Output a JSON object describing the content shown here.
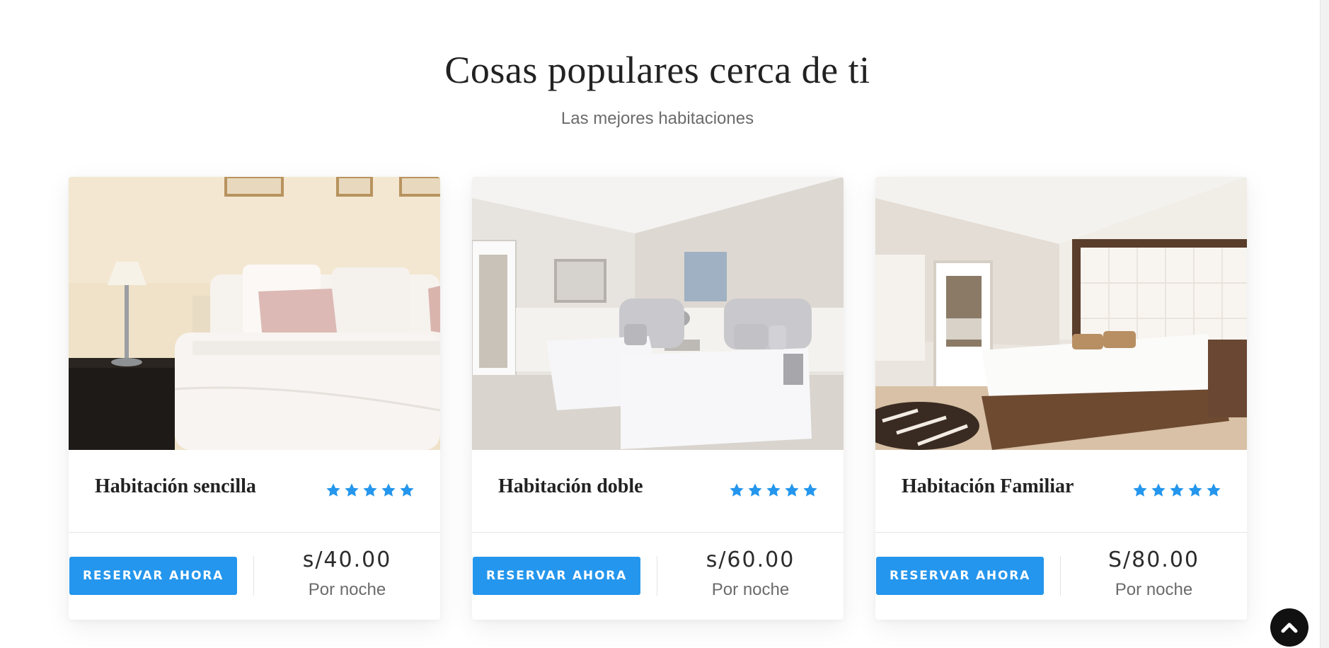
{
  "section": {
    "title": "Cosas populares cerca de ti",
    "subtitle": "Las mejores habitaciones"
  },
  "rooms": [
    {
      "name": "Habitación sencilla",
      "rating": 5,
      "button_label": "RESERVAR AHORA",
      "price": "s/40.00",
      "price_unit": "Por noche",
      "image": "bedroom-single-photo"
    },
    {
      "name": "Habitación doble",
      "rating": 5,
      "button_label": "RESERVAR AHORA",
      "price": "s/60.00",
      "price_unit": "Por noche",
      "image": "bedroom-double-photo"
    },
    {
      "name": "Habitación Familiar",
      "rating": 5,
      "button_label": "RESERVAR AHORA",
      "price": "S/80.00",
      "price_unit": "Por noche",
      "image": "bedroom-family-photo"
    }
  ],
  "icons": {
    "rating": "star-icon",
    "scroll_top": "chevron-up-icon"
  },
  "colors": {
    "accent": "#2496ed",
    "title": "#222222",
    "muted": "#6b6b6b",
    "scroll_top_bg": "#111111"
  }
}
